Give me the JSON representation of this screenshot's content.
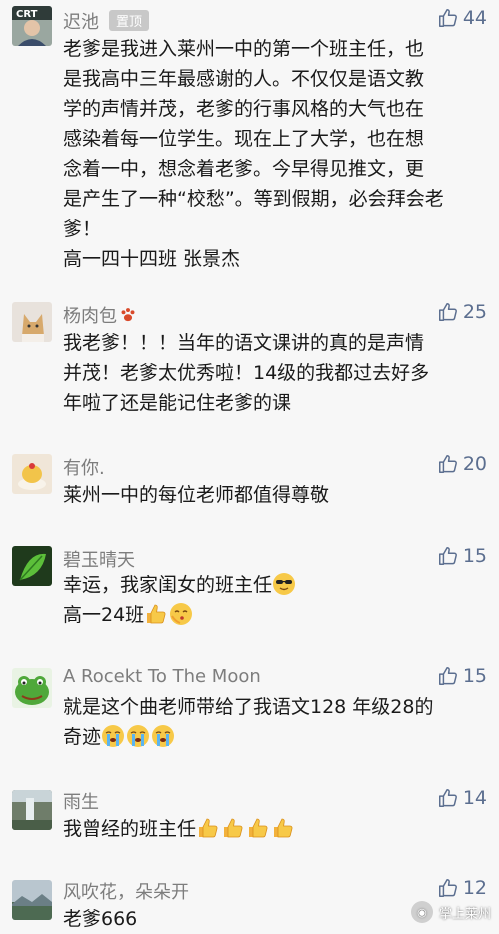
{
  "comments": [
    {
      "name": "迟池",
      "pin_label": "置顶",
      "likes": "44",
      "avatar_icon": "portrait-photo",
      "lines": [
        "老爹是我进入莱州一中的第一个班主任，也",
        "是我高中三年最感谢的人。不仅仅是语文教",
        "学的声情并茂，老爹的行事风格的大气也在",
        "感染着每一位学生。现在上了大学，也在想",
        "念着一中，想念着老爹。今早得见推文，更",
        "是产生了一种“校愁”。等到假期，必会拜会老",
        "爹！",
        "高一四十四班  张景杰"
      ]
    },
    {
      "name": "杨肉包",
      "name_icon": "paw-icon",
      "likes": "25",
      "avatar_icon": "cat-photo",
      "lines": [
        "我老爹！！！当年的语文课讲的真的是声情",
        "并茂！老爹太优秀啦！14级的我都过去好多",
        "年啦了还是能记住老爹的课"
      ]
    },
    {
      "name": "有你.",
      "likes": "20",
      "avatar_icon": "dessert-photo",
      "lines": [
        "莱州一中的每位老师都值得尊敬"
      ]
    },
    {
      "name": "碧玉晴天",
      "likes": "15",
      "avatar_icon": "green-leaf-photo",
      "line1": "幸运，我家闺女的班主任",
      "line2": "高一24班"
    },
    {
      "name": "A Rocekt To The Moon",
      "likes": "15",
      "avatar_icon": "frog-cartoon",
      "line1": "就是这个曲老师带给了我语文128 年级28的",
      "line2": "奇迹"
    },
    {
      "name": "雨生",
      "likes": "14",
      "avatar_icon": "waterfall-photo",
      "line1": "我曾经的班主任"
    },
    {
      "name": "风吹花，朵朵开",
      "likes": "12",
      "avatar_icon": "landscape-photo",
      "line1": "老爹666"
    }
  ],
  "watermark": "掌上莱州",
  "colors": {
    "background": "#f7f7f7",
    "name_text": "#7d7d7d",
    "like_text": "#5b6e8f",
    "pin_bg": "#c8c8c8"
  }
}
